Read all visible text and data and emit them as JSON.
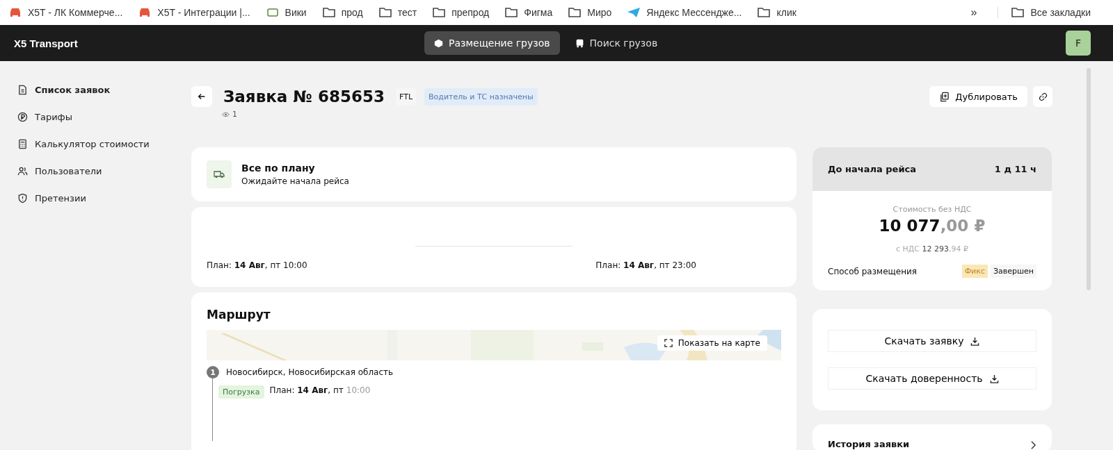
{
  "bookmarks": [
    {
      "label": "X5T - ЛК Коммерче...",
      "kind": "car"
    },
    {
      "label": "X5T - Интеграции |...",
      "kind": "car"
    },
    {
      "label": "Вики",
      "kind": "logo"
    },
    {
      "label": "прод",
      "kind": "folder"
    },
    {
      "label": "тест",
      "kind": "folder"
    },
    {
      "label": "препрод",
      "kind": "folder"
    },
    {
      "label": "Фигма",
      "kind": "folder"
    },
    {
      "label": "Миро",
      "kind": "folder"
    },
    {
      "label": "Яндекс Мессендже...",
      "kind": "plane"
    },
    {
      "label": "клик",
      "kind": "folder"
    }
  ],
  "bookmarks_more": "»",
  "all_bookmarks": "Все закладки",
  "header": {
    "logo": "X5 Transport",
    "tabs": [
      {
        "label": "Размещение грузов",
        "selected": true,
        "kind": "box"
      },
      {
        "label": "Поиск грузов",
        "selected": false,
        "kind": "bus"
      }
    ],
    "avatar": "F"
  },
  "sidebar": {
    "items": [
      {
        "label": "Список заявок",
        "kind": "doc",
        "selected": true
      },
      {
        "label": "Тарифы",
        "kind": "ruble",
        "selected": false
      },
      {
        "label": "Калькулятор стоимости",
        "kind": "calc",
        "selected": false
      },
      {
        "label": "Пользователи",
        "kind": "users",
        "selected": false
      },
      {
        "label": "Претензии",
        "kind": "shield",
        "selected": false
      }
    ]
  },
  "order": {
    "title": "Заявка № 685653",
    "type_tag": "FTL",
    "status_tag": "Водитель и ТС назначены",
    "views": "1",
    "duplicate_button": "Дублировать"
  },
  "status_card": {
    "title": "Все по плану",
    "subtitle": "Ожидайте начала рейса"
  },
  "plan_card": {
    "start": "План: **14 Авг**, пт 10:00",
    "end": "План: **14 Авг**, пт 23:00"
  },
  "route": {
    "title": "Маршрут",
    "map_button": "Показать на карте",
    "stops": [
      {
        "number": "1",
        "address": "Новосибирск, Новосибирская область",
        "tag": "Погрузка",
        "plan": "План: **14 Авг**, пт",
        "time": "10:00"
      }
    ]
  },
  "timer": {
    "label": "До начала рейса",
    "value": "1 д 11 ч"
  },
  "price": {
    "label": "Стоимость без НДС",
    "main": "10 077",
    "cents": ",00 ₽",
    "vat_label": "с НДС",
    "vat_main": "12 293",
    "vat_cents": ",94 ₽",
    "method_label": "Способ размещения",
    "method_tag": "Фикс",
    "method_status": "Завершен"
  },
  "downloads": [
    "Скачать заявку",
    "Скачать доверенность"
  ],
  "history": {
    "title": "История заявки"
  }
}
